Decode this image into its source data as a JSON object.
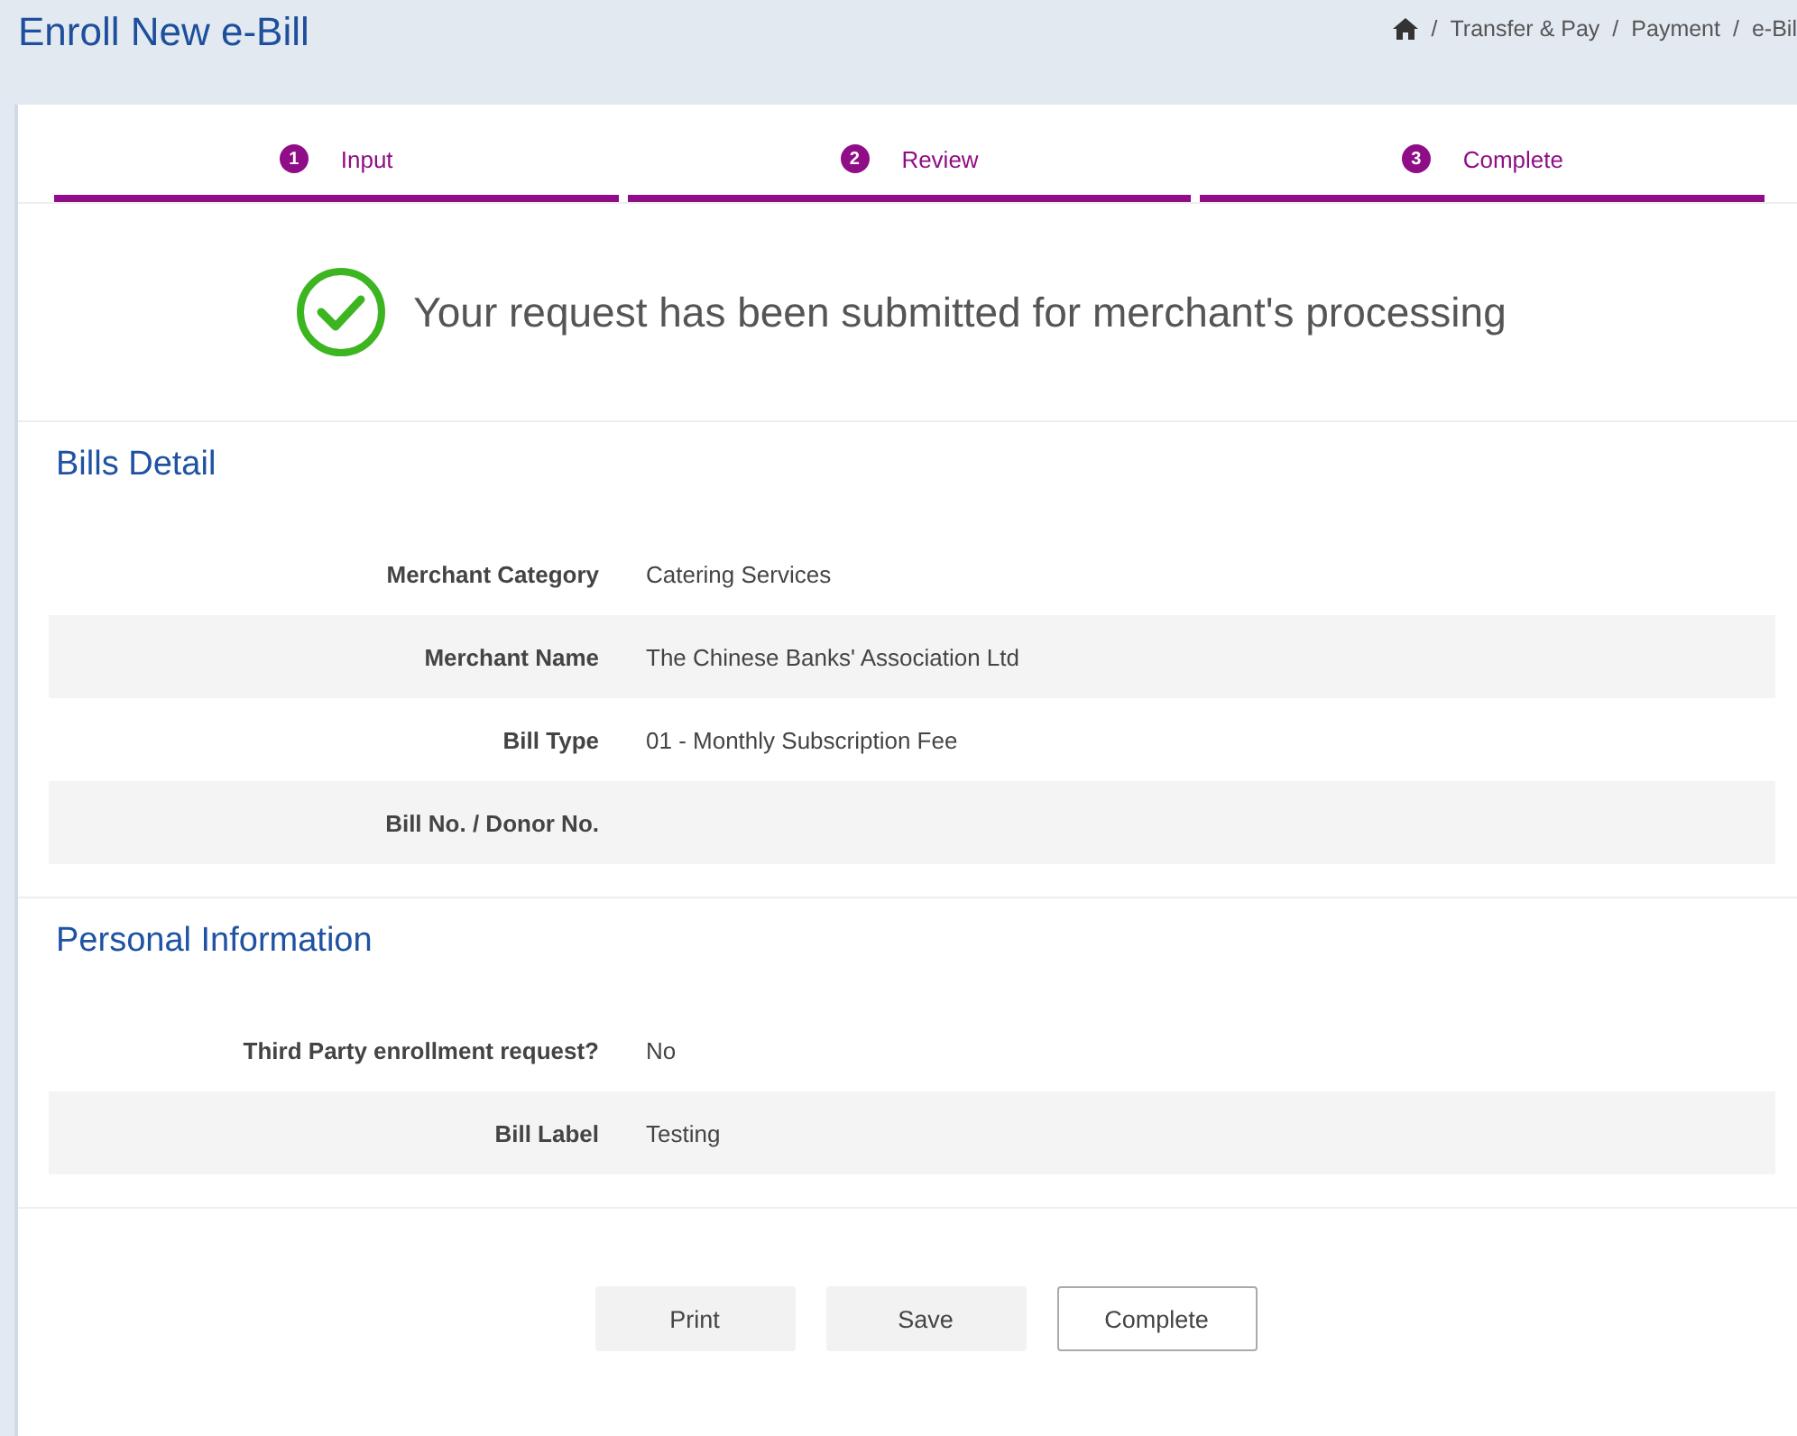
{
  "page_title": "Enroll New e-Bill",
  "breadcrumb": {
    "separator": "/",
    "items": [
      "Transfer & Pay",
      "Payment",
      "e-Bil"
    ]
  },
  "steps": [
    {
      "number": "1",
      "label": "Input",
      "done": true
    },
    {
      "number": "2",
      "label": "Review",
      "done": true
    },
    {
      "number": "3",
      "label": "Complete",
      "done": true
    }
  ],
  "message": "Your request has been submitted for merchant's processing",
  "sections": [
    {
      "title": "Bills Detail",
      "rows": [
        {
          "label": "Merchant Category",
          "value": "Catering Services"
        },
        {
          "label": "Merchant Name",
          "value": "The Chinese Banks' Association Ltd"
        },
        {
          "label": "Bill Type",
          "value": "01 - Monthly Subscription Fee"
        },
        {
          "label": "Bill No. / Donor No."
        }
      ]
    },
    {
      "title": "Personal Information",
      "rows": [
        {
          "label": "Third Party enrollment request?",
          "value": "No"
        },
        {
          "label": "Bill Label",
          "value": "Testing"
        }
      ]
    }
  ],
  "buttons": [
    {
      "label": "Print",
      "kind": "secondary"
    },
    {
      "label": "Save",
      "kind": "secondary"
    },
    {
      "label": "Complete",
      "kind": "outline"
    }
  ]
}
